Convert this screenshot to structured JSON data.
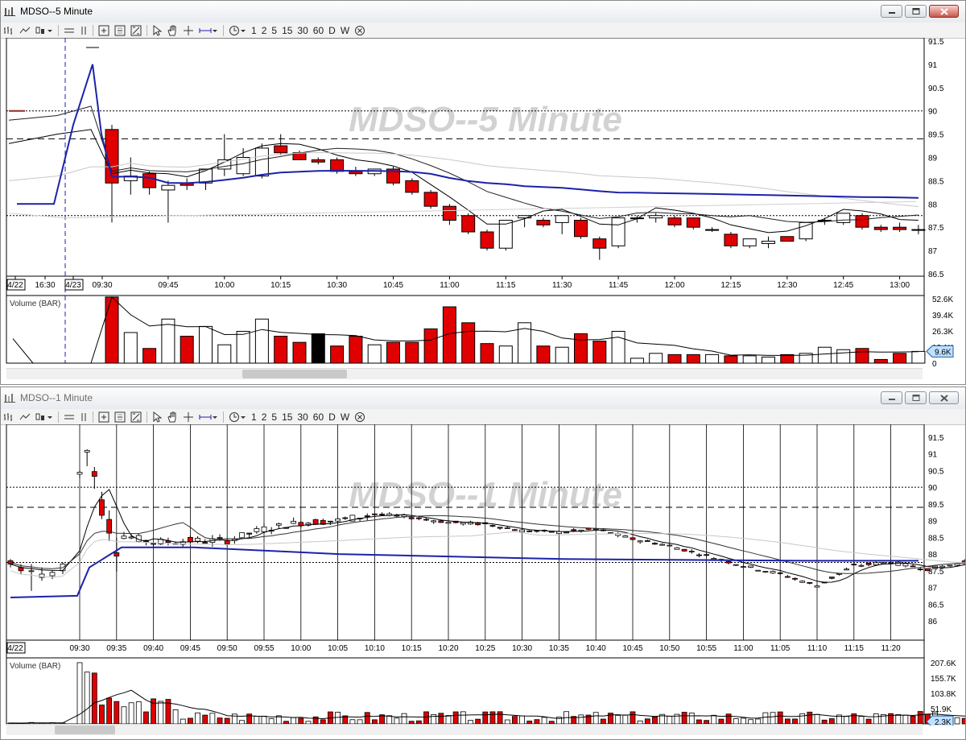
{
  "windows": [
    {
      "title": "MDSO--5 Minute",
      "watermark": "MDSO--5 Minute",
      "volume_label": "Volume (BAR)",
      "price_axis_labels": [
        "91.5",
        "91",
        "90.5",
        "90",
        "89.5",
        "89",
        "88.5",
        "88",
        "87.5",
        "87",
        "86.5"
      ],
      "time_axis_labels": [
        "4/22",
        "16:30",
        "4/23",
        "09:30",
        "09:45",
        "10:00",
        "10:15",
        "10:30",
        "10:45",
        "11:00",
        "11:15",
        "11:30",
        "11:45",
        "12:00",
        "12:15",
        "12:30",
        "12:45",
        "13:00"
      ],
      "volume_axis_labels": [
        "52.6K",
        "39.4K",
        "26.3K",
        "13.1K",
        "0"
      ],
      "current_volume_badge": "9.6K"
    },
    {
      "title": "MDSO--1 Minute",
      "watermark": "MDSO--1 Minute",
      "volume_label": "Volume (BAR)",
      "price_axis_labels": [
        "91.5",
        "91",
        "90.5",
        "90",
        "89.5",
        "89",
        "88.5",
        "88",
        "87.5",
        "87",
        "86.5",
        "86"
      ],
      "time_axis_labels": [
        "4/22",
        "09:30",
        "09:35",
        "09:40",
        "09:45",
        "09:50",
        "09:55",
        "10:00",
        "10:05",
        "10:10",
        "10:15",
        "10:20",
        "10:25",
        "10:30",
        "10:35",
        "10:40",
        "10:45",
        "10:50",
        "10:55",
        "11:00",
        "11:05",
        "11:10",
        "11:15",
        "11:20"
      ],
      "volume_axis_labels": [
        "207.6K",
        "155.7K",
        "103.8K",
        "51.9K"
      ],
      "current_volume_badge": "2.3K"
    }
  ],
  "toolbar": {
    "interval_buttons": [
      "1",
      "2",
      "5",
      "15",
      "30",
      "60",
      "D",
      "W"
    ]
  },
  "colors": {
    "down_candle": "#e00000",
    "up_candle": "#ffffff",
    "vwap_line": "#1c22a8",
    "guide_line": "#000000",
    "watermark": "#c8c8c8"
  },
  "chart_data": [
    {
      "type": "candlestick",
      "timeframe": "5 Minute",
      "y_range": [
        86.5,
        91.5
      ],
      "reference_lines": [
        90.0,
        89.4,
        87.75
      ],
      "candles": [
        {
          "time": "09:30",
          "open": 89.6,
          "high": 89.7,
          "low": 87.6,
          "close": 88.45
        },
        {
          "time": "09:35",
          "open": 88.5,
          "high": 89.0,
          "low": 88.2,
          "close": 88.6
        },
        {
          "time": "09:40",
          "open": 88.65,
          "high": 88.7,
          "low": 88.2,
          "close": 88.35
        },
        {
          "time": "09:45",
          "open": 88.3,
          "high": 88.5,
          "low": 87.6,
          "close": 88.4
        },
        {
          "time": "09:50",
          "open": 88.45,
          "high": 88.55,
          "low": 88.3,
          "close": 88.4
        },
        {
          "time": "09:55",
          "open": 88.45,
          "high": 88.75,
          "low": 88.3,
          "close": 88.75
        },
        {
          "time": "10:00",
          "open": 88.75,
          "high": 89.5,
          "low": 88.6,
          "close": 88.95
        },
        {
          "time": "10:05",
          "open": 88.65,
          "high": 89.2,
          "low": 88.6,
          "close": 89.0
        },
        {
          "time": "10:10",
          "open": 88.6,
          "high": 89.3,
          "low": 88.55,
          "close": 89.2
        },
        {
          "time": "10:15",
          "open": 89.25,
          "high": 89.5,
          "low": 89.05,
          "close": 89.1
        },
        {
          "time": "10:20",
          "open": 89.1,
          "high": 89.15,
          "low": 88.95,
          "close": 88.95
        },
        {
          "time": "10:25",
          "open": 88.95,
          "high": 89.0,
          "low": 88.85,
          "close": 88.9
        },
        {
          "time": "10:30",
          "open": 88.95,
          "high": 89.0,
          "low": 88.65,
          "close": 88.7
        },
        {
          "time": "10:35",
          "open": 88.7,
          "high": 88.8,
          "low": 88.6,
          "close": 88.65
        },
        {
          "time": "10:40",
          "open": 88.65,
          "high": 88.75,
          "low": 88.6,
          "close": 88.75
        },
        {
          "time": "10:45",
          "open": 88.75,
          "high": 88.8,
          "low": 88.4,
          "close": 88.45
        },
        {
          "time": "10:50",
          "open": 88.5,
          "high": 88.55,
          "low": 88.2,
          "close": 88.25
        },
        {
          "time": "10:55",
          "open": 88.25,
          "high": 88.3,
          "low": 87.9,
          "close": 87.95
        },
        {
          "time": "11:00",
          "open": 87.95,
          "high": 88.0,
          "low": 87.55,
          "close": 87.65
        },
        {
          "time": "11:05",
          "open": 87.75,
          "high": 87.8,
          "low": 87.35,
          "close": 87.4
        },
        {
          "time": "11:10",
          "open": 87.4,
          "high": 87.45,
          "low": 87.0,
          "close": 87.05
        },
        {
          "time": "11:15",
          "open": 87.05,
          "high": 87.65,
          "low": 87.0,
          "close": 87.65
        },
        {
          "time": "11:20",
          "open": 87.7,
          "high": 87.75,
          "low": 87.5,
          "close": 87.75
        },
        {
          "time": "11:25",
          "open": 87.65,
          "high": 87.7,
          "low": 87.5,
          "close": 87.55
        },
        {
          "time": "11:30",
          "open": 87.6,
          "high": 87.75,
          "low": 87.35,
          "close": 87.75
        },
        {
          "time": "11:35",
          "open": 87.65,
          "high": 87.7,
          "low": 87.25,
          "close": 87.3
        },
        {
          "time": "11:40",
          "open": 87.25,
          "high": 87.3,
          "low": 86.8,
          "close": 87.05
        },
        {
          "time": "11:45",
          "open": 87.1,
          "high": 87.7,
          "low": 87.05,
          "close": 87.7
        },
        {
          "time": "11:50",
          "open": 87.7,
          "high": 87.75,
          "low": 87.6,
          "close": 87.7
        },
        {
          "time": "11:55",
          "open": 87.7,
          "high": 87.8,
          "low": 87.6,
          "close": 87.75
        },
        {
          "time": "12:00",
          "open": 87.7,
          "high": 87.75,
          "low": 87.5,
          "close": 87.55
        },
        {
          "time": "12:05",
          "open": 87.7,
          "high": 87.7,
          "low": 87.45,
          "close": 87.5
        },
        {
          "time": "12:10",
          "open": 87.45,
          "high": 87.5,
          "low": 87.4,
          "close": 87.45
        },
        {
          "time": "12:15",
          "open": 87.35,
          "high": 87.4,
          "low": 87.05,
          "close": 87.1
        },
        {
          "time": "12:20",
          "open": 87.1,
          "high": 87.25,
          "low": 87.05,
          "close": 87.25
        },
        {
          "time": "12:25",
          "open": 87.15,
          "high": 87.3,
          "low": 87.05,
          "close": 87.2
        },
        {
          "time": "12:30",
          "open": 87.3,
          "high": 87.3,
          "low": 87.2,
          "close": 87.2
        },
        {
          "time": "12:35",
          "open": 87.25,
          "high": 87.6,
          "low": 87.2,
          "close": 87.6
        },
        {
          "time": "12:40",
          "open": 87.65,
          "high": 87.7,
          "low": 87.55,
          "close": 87.65
        },
        {
          "time": "12:45",
          "open": 87.6,
          "high": 87.8,
          "low": 87.55,
          "close": 87.8
        },
        {
          "time": "12:50",
          "open": 87.75,
          "high": 87.8,
          "low": 87.45,
          "close": 87.5
        },
        {
          "time": "12:55",
          "open": 87.5,
          "high": 87.55,
          "low": 87.4,
          "close": 87.45
        },
        {
          "time": "13:00",
          "open": 87.5,
          "high": 87.6,
          "low": 87.4,
          "close": 87.45
        },
        {
          "time": "13:05",
          "open": 87.45,
          "high": 87.55,
          "low": 87.35,
          "close": 87.45
        }
      ],
      "volume": [
        54,
        25,
        12,
        36,
        22,
        30,
        15,
        26,
        36,
        22,
        17,
        24,
        14,
        22,
        15,
        17,
        17,
        28,
        46,
        33,
        16,
        14,
        33,
        14,
        13,
        24,
        18,
        26,
        4,
        8,
        7,
        7,
        7,
        6,
        6,
        5,
        7,
        8,
        13,
        11,
        12,
        3,
        8,
        9.6
      ]
    },
    {
      "type": "candlestick",
      "timeframe": "1 Minute",
      "y_range": [
        86.0,
        91.5
      ],
      "reference_lines": [
        90.0,
        89.4,
        87.75
      ],
      "note_series": [
        "vwap",
        "moving averages"
      ]
    }
  ]
}
